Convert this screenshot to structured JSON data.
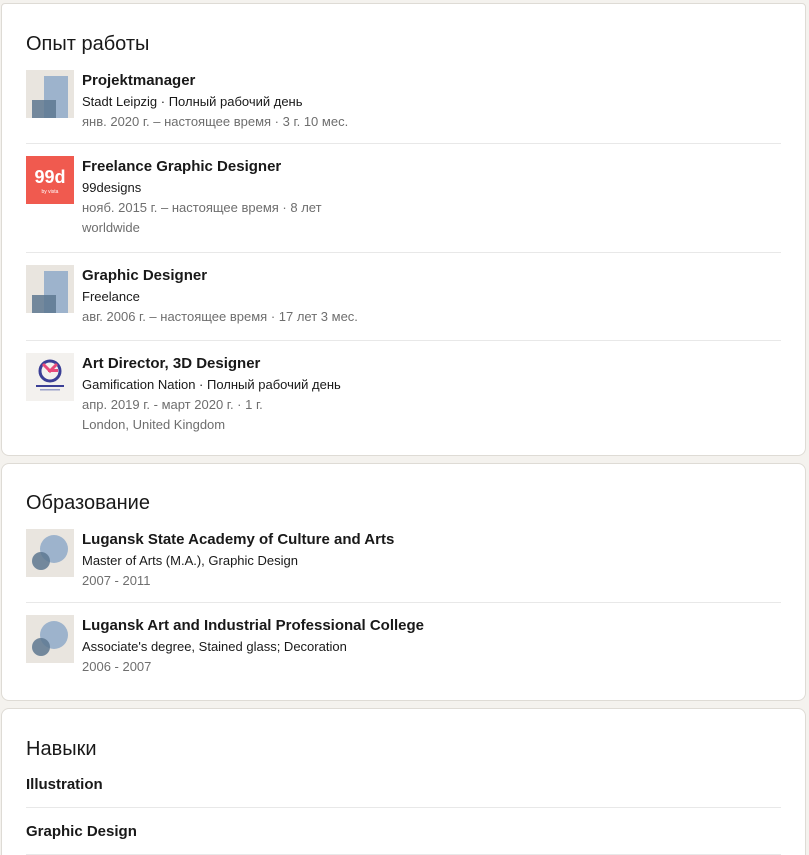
{
  "experience": {
    "title": "Опыт работы",
    "items": [
      {
        "title": "Projektmanager",
        "subtitle": "Stadt Leipzig · Полный рабочий день",
        "dates": "янв. 2020 г. – настоящее время · 3 г. 10 мес.",
        "location": "",
        "logo": "company-placeholder-icon"
      },
      {
        "title": "Freelance Graphic Designer",
        "subtitle": "99designs",
        "dates": "нояб. 2015 г. – настоящее время · 8 лет",
        "location": "worldwide",
        "logo": "99designs-logo",
        "logo_text": "99d",
        "logo_subtext": "by vista"
      },
      {
        "title": "Graphic Designer",
        "subtitle": "Freelance",
        "dates": "авг. 2006 г. – настоящее время · 17 лет 3 мес.",
        "location": "",
        "logo": "company-placeholder-icon"
      },
      {
        "title": "Art Director, 3D Designer",
        "subtitle": "Gamification Nation · Полный рабочий день",
        "dates": "апр. 2019 г. - март 2020 г. · 1 г.",
        "location": "London, United Kingdom",
        "logo": "gamification-nation-logo"
      }
    ]
  },
  "education": {
    "title": "Образование",
    "items": [
      {
        "title": "Lugansk State Academy of Culture and Arts",
        "subtitle": "Master of Arts (M.A.), Graphic Design",
        "dates": "2007 - 2011",
        "logo": "school-placeholder-icon"
      },
      {
        "title": "Lugansk Art and Industrial Professional College",
        "subtitle": "Associate's degree, Stained glass; Decoration",
        "dates": "2006 - 2007",
        "logo": "school-placeholder-icon"
      }
    ]
  },
  "skills": {
    "title": "Навыки",
    "items": [
      "Illustration",
      "Graphic Design"
    ]
  },
  "colors": {
    "page_bg": "#f4f2ee",
    "card_bg": "#ffffff",
    "text_primary": "#191919",
    "text_secondary": "#6e6e6e",
    "brand_99designs": "#f05a4f",
    "placeholder_bg": "#e9e5df",
    "placeholder_blue": "#9db3cc",
    "placeholder_dark": "#5e7891"
  }
}
